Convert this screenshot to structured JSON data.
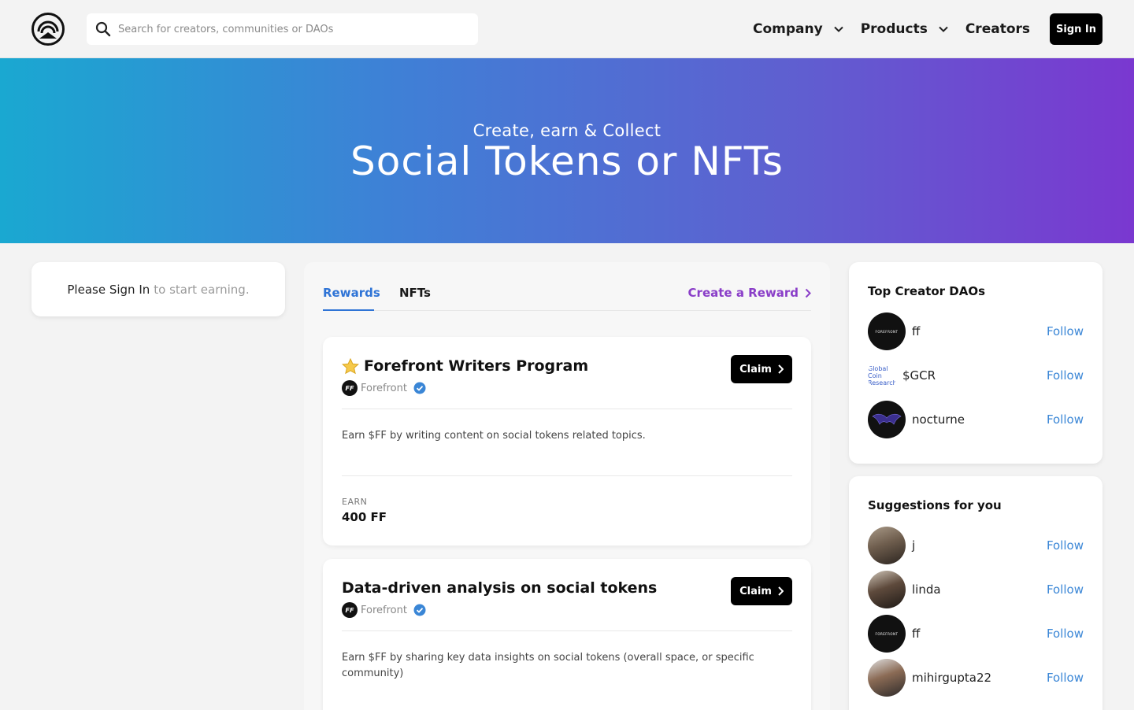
{
  "header": {
    "search_placeholder": "Search for creators, communities or DAOs",
    "nav": [
      {
        "label": "Company"
      },
      {
        "label": "Products"
      },
      {
        "label": "Creators"
      }
    ],
    "signin_label": "Sign In"
  },
  "hero": {
    "subtitle": "Create, earn & Collect",
    "title": "Social Tokens or NFTs"
  },
  "signin_card": {
    "strong": "Please Sign In",
    "muted": "to start earning."
  },
  "tabs": {
    "rewards": "Rewards",
    "nfts": "NFTs",
    "create": "Create a Reward"
  },
  "rewards": [
    {
      "title": "Forefront Writers Program",
      "org_logo": "FF",
      "org": "Forefront",
      "claim": "Claim",
      "description": "Earn $FF by writing content on social tokens related topics.",
      "earn_label": "EARN",
      "earn_value": "400 FF"
    },
    {
      "title": "Data-driven analysis on social tokens",
      "org_logo": "FF",
      "org": "Forefront",
      "claim": "Claim",
      "description": "Earn $FF by sharing key data insights on social tokens (overall space, or specific community)"
    }
  ],
  "top_daos": {
    "title": "Top Creator DAOs",
    "items": [
      {
        "name": "ff",
        "avatar_text": "FOREFRONT",
        "follow": "Follow"
      },
      {
        "name": "$GCR",
        "avatar_text": "Global Coin Research",
        "follow": "Follow"
      },
      {
        "name": "nocturne",
        "follow": "Follow"
      }
    ]
  },
  "suggestions": {
    "title": "Suggestions for you",
    "items": [
      {
        "name": "j",
        "follow": "Follow"
      },
      {
        "name": "linda",
        "follow": "Follow"
      },
      {
        "name": "ff",
        "avatar_text": "FOREFRONT",
        "follow": "Follow"
      },
      {
        "name": "mihirgupta22",
        "follow": "Follow"
      }
    ]
  },
  "colors": {
    "accent_blue": "#2f74d6",
    "create_purple": "#8a3ec8",
    "follow_blue": "#3a86d6",
    "hero_gradient_start": "#1aa8d1",
    "hero_gradient_end": "#7a38d0"
  }
}
